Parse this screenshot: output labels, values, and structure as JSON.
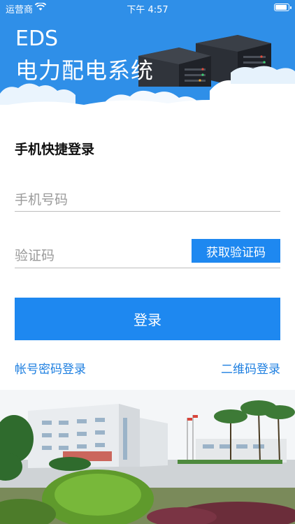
{
  "status_bar": {
    "carrier": "运营商",
    "time": "下午 4:57"
  },
  "header": {
    "title_line1": "EDS",
    "title_line2": "电力配电系统"
  },
  "form": {
    "heading": "手机快捷登录",
    "phone_placeholder": "手机号码",
    "code_placeholder": "验证码",
    "get_code_label": "获取验证码",
    "login_label": "登录"
  },
  "links": {
    "account_login": "帐号密码登录",
    "qr_login": "二维码登录"
  },
  "colors": {
    "header_bg": "#2f8fe8",
    "primary": "#1e88f0",
    "link": "#1e7fe0"
  },
  "icons": [
    "wifi-icon",
    "battery-icon"
  ]
}
